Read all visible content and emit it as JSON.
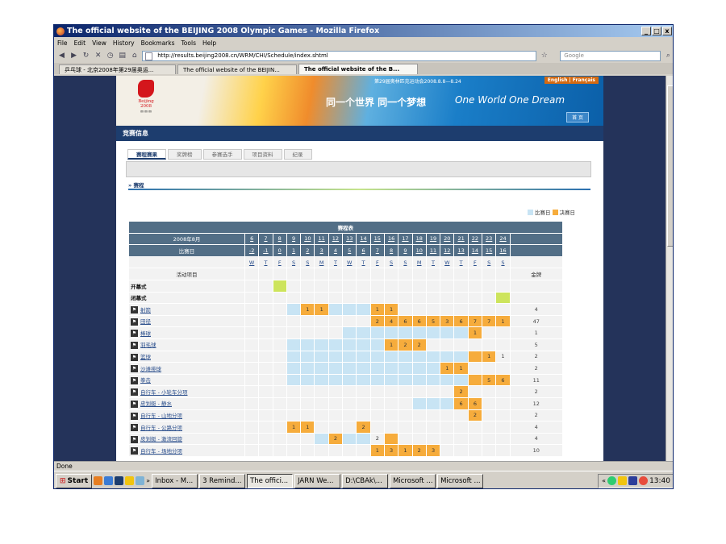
{
  "window": {
    "title": "The official website of the BEIJING 2008 Olympic Games - Mozilla Firefox"
  },
  "menu": [
    "File",
    "Edit",
    "View",
    "History",
    "Bookmarks",
    "Tools",
    "Help"
  ],
  "nav": {
    "url": "http://results.beijing2008.cn/WRM/CHI/Schedule/index.shtml",
    "search_placeholder": "Google"
  },
  "tabs": [
    "乒乓球 - 北京2008年第29届奥运...",
    "The official website of the BEIJIN...",
    "The official website of the B..."
  ],
  "banner": {
    "top_text": "第29届奥林匹克运动会2008.8.8—8.24",
    "lang": "English | Français",
    "logo_text": "Beijing 2008",
    "slogan_cn": "同一个世界 同一个梦想",
    "slogan_en": "One World One Dream",
    "home": "首 页"
  },
  "section_title": "竞赛信息",
  "page_tabs": [
    "赛程赛果",
    "奖牌榜",
    "参赛选手",
    "项目资料",
    "纪录"
  ],
  "breadcrumb": "» 赛程",
  "legend": {
    "competition": "比赛日",
    "final": "决赛日"
  },
  "schedule": {
    "title": "赛程表",
    "month_label": "2008年8月",
    "dates": [
      "6",
      "7",
      "8",
      "9",
      "10",
      "11",
      "12",
      "13",
      "14",
      "15",
      "16",
      "17",
      "18",
      "19",
      "20",
      "21",
      "22",
      "23",
      "24"
    ],
    "day_label": "比赛日",
    "day_nums": [
      "-2",
      "-1",
      "0",
      "1",
      "2",
      "3",
      "4",
      "5",
      "6",
      "7",
      "8",
      "9",
      "10",
      "11",
      "12",
      "13",
      "14",
      "15",
      "16"
    ],
    "weekdays": [
      "W",
      "T",
      "F",
      "S",
      "S",
      "M",
      "T",
      "W",
      "T",
      "F",
      "S",
      "S",
      "M",
      "T",
      "W",
      "T",
      "F",
      "S",
      "S"
    ],
    "event_header": "活动项目",
    "medal_header": "金牌",
    "rows": [
      {
        "name": "开幕式",
        "plain": true,
        "cells": "--g----------------",
        "nums": {},
        "medals": ""
      },
      {
        "name": "闭幕式",
        "plain": true,
        "cells": "------------------g",
        "nums": {},
        "medals": ""
      },
      {
        "name": "射箭",
        "icon": "archery-icon",
        "cells": "---cffcccff--------",
        "nums": {
          "4": "1",
          "5": "1",
          "9": "1",
          "10": "1"
        },
        "medals": "4"
      },
      {
        "name": "田径",
        "icon": "athletics-icon",
        "cells": "---------ffffffffff",
        "nums": {
          "9": "2",
          "10": "4",
          "11": "6",
          "12": "6",
          "13": "5",
          "14": "3",
          "15": "6",
          "16": "7",
          "17": "7",
          "18": "1"
        },
        "medals": "47"
      },
      {
        "name": "棒球",
        "icon": "baseball-icon",
        "cells": "-------cccccccccf--",
        "nums": {
          "16": "1"
        },
        "medals": "1"
      },
      {
        "name": "羽毛球",
        "icon": "badminton-icon",
        "cells": "---cccccccfff------",
        "nums": {
          "10": "1",
          "11": "2",
          "12": "2"
        },
        "medals": "5"
      },
      {
        "name": "篮球",
        "icon": "basketball-icon",
        "cells": "---cccccccccccccff-",
        "nums": {
          "17": "1",
          "18": "1"
        },
        "medals": "2"
      },
      {
        "name": "沙滩排球",
        "icon": "beach-volleyball-icon",
        "cells": "---cccccccccccff---",
        "nums": {
          "14": "1",
          "15": "1"
        },
        "medals": "2"
      },
      {
        "name": "拳击",
        "icon": "boxing-icon",
        "cells": "---cccccccccccccfff",
        "nums": {
          "17": "5",
          "18": "6"
        },
        "medals": "11"
      },
      {
        "name": "自行车 - 小轮车分项",
        "icon": "bmx-icon",
        "cells": "---------------f---",
        "nums": {
          "15": "2"
        },
        "medals": "2"
      },
      {
        "name": "皮划艇 - 静水",
        "icon": "canoe-flatwater-icon",
        "cells": "------------cccff--",
        "nums": {
          "15": "6",
          "16": "6"
        },
        "medals": "12"
      },
      {
        "name": "自行车 - 山地分项",
        "icon": "mountain-bike-icon",
        "cells": "----------------f--",
        "nums": {
          "16": "2"
        },
        "medals": "2"
      },
      {
        "name": "自行车 - 公路分项",
        "icon": "road-cycling-icon",
        "cells": "---ff---f----------",
        "nums": {
          "3": "1",
          "4": "1",
          "8": "2"
        },
        "medals": "4"
      },
      {
        "name": "皮划艇 - 激流回旋",
        "icon": "canoe-slalom-icon",
        "cells": "-----cfcc-f--------",
        "nums": {
          "6": "2",
          "9": "2"
        },
        "medals": "4"
      },
      {
        "name": "自行车 - 场地分项",
        "icon": "track-cycling-icon",
        "cells": "---------fffff-----",
        "nums": {
          "9": "1",
          "10": "3",
          "11": "1",
          "12": "2",
          "13": "3"
        },
        "medals": "10"
      }
    ]
  },
  "status": "Done",
  "taskbar": {
    "start": "Start",
    "tasks": [
      "Inbox - M...",
      "3 Remind...",
      "The offici...",
      "JARN We...",
      "D:\\CBAk\\...",
      "Microsoft ...",
      "Microsoft ..."
    ],
    "clock": "13:40"
  }
}
